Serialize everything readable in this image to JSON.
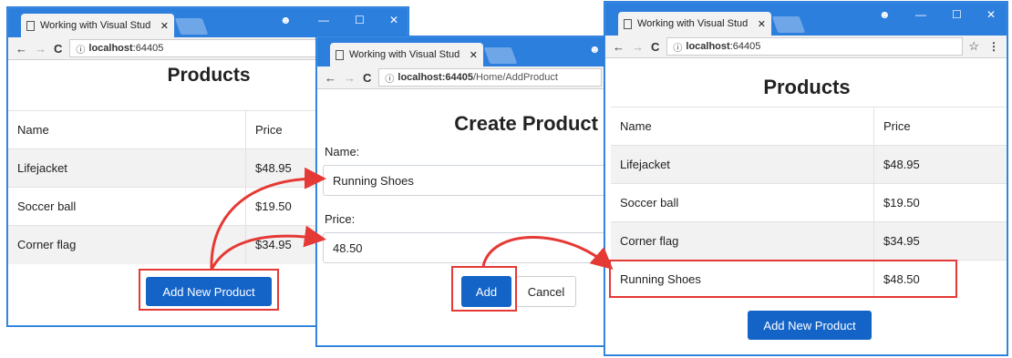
{
  "windows": {
    "list_left": {
      "tab_title": "Working with Visual Stud",
      "tab_close": "✕",
      "address": {
        "host": "localhost",
        "port": ":64405",
        "path": ""
      },
      "page_title": "Products",
      "table": {
        "headers": [
          "Name",
          "Price"
        ],
        "rows": [
          {
            "name": "Lifejacket",
            "price": "$48.95"
          },
          {
            "name": "Soccer ball",
            "price": "$19.50"
          },
          {
            "name": "Corner flag",
            "price": "$34.95"
          }
        ]
      },
      "add_button_label": "Add New Product"
    },
    "create": {
      "tab_title": "Working with Visual Stud",
      "tab_close": "✕",
      "address": {
        "host": "localhost",
        "port": ":64405",
        "path": "/Home/AddProduct"
      },
      "page_title": "Create Product",
      "name_label": "Name:",
      "name_value": "Running Shoes",
      "price_label": "Price:",
      "price_value": "48.50",
      "add_label": "Add",
      "cancel_label": "Cancel"
    },
    "list_right": {
      "tab_title": "Working with Visual Stud",
      "tab_close": "✕",
      "address": {
        "host": "localhost",
        "port": ":64405",
        "path": ""
      },
      "page_title": "Products",
      "table": {
        "headers": [
          "Name",
          "Price"
        ],
        "rows": [
          {
            "name": "Lifejacket",
            "price": "$48.95"
          },
          {
            "name": "Soccer ball",
            "price": "$19.50"
          },
          {
            "name": "Corner flag",
            "price": "$34.95"
          },
          {
            "name": "Running Shoes",
            "price": "$48.50"
          }
        ]
      },
      "add_button_label": "Add New Product"
    }
  },
  "icons": {
    "account": "☻",
    "minimize": "—",
    "maximize": "☐",
    "close": "✕",
    "back": "←",
    "forward": "→",
    "reload": "C",
    "info": "ⓘ",
    "star": "☆",
    "menu": "⋮"
  },
  "colors": {
    "chrome_titlebar": "#2d7fdd",
    "primary_button": "#1464c8",
    "highlight": "#e53935"
  }
}
